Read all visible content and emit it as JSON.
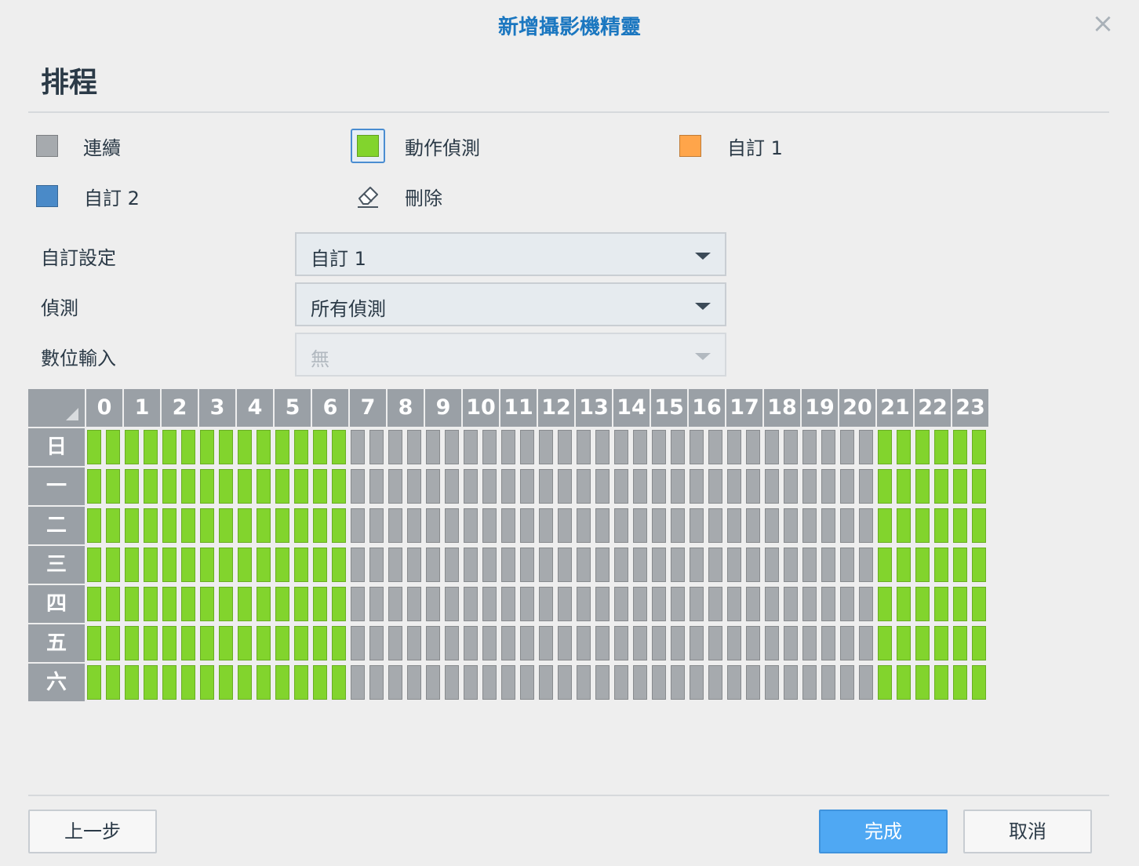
{
  "dialog": {
    "title": "新增攝影機精靈",
    "close_icon": "×"
  },
  "section_title": "排程",
  "legend": [
    {
      "id": "continuous",
      "label": "連續",
      "color": "#a6aaae",
      "selected": false
    },
    {
      "id": "motion",
      "label": "動作偵測",
      "color": "#82d42d",
      "selected": true
    },
    {
      "id": "custom1",
      "label": "自訂 1",
      "color": "#ffa54a",
      "selected": false
    },
    {
      "id": "custom2",
      "label": "自訂 2",
      "color": "#4a8ac8",
      "selected": false
    },
    {
      "id": "delete",
      "label": "刪除",
      "icon": "eraser-icon",
      "selected": false
    }
  ],
  "form": {
    "custom_setting": {
      "label": "自訂設定",
      "value": "自訂 1"
    },
    "detection": {
      "label": "偵測",
      "value": "所有偵測"
    },
    "digital_input": {
      "label": "數位輸入",
      "value": "無",
      "disabled": true
    }
  },
  "schedule": {
    "hours": [
      "0",
      "1",
      "2",
      "3",
      "4",
      "5",
      "6",
      "7",
      "8",
      "9",
      "10",
      "11",
      "12",
      "13",
      "14",
      "15",
      "16",
      "17",
      "18",
      "19",
      "20",
      "21",
      "22",
      "23"
    ],
    "days": [
      "日",
      "一",
      "二",
      "三",
      "四",
      "五",
      "六"
    ],
    "slots_per_hour": 2,
    "motion_slots": [
      [
        0,
        14
      ],
      [
        42,
        48
      ]
    ],
    "colors": {
      "motion": "#82d42d",
      "continuous": "#a6aaae"
    }
  },
  "buttons": {
    "back": "上一步",
    "finish": "完成",
    "cancel": "取消"
  }
}
